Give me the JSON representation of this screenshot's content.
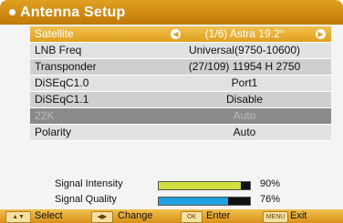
{
  "header": {
    "title": "Antenna Setup"
  },
  "menu": {
    "satellite": {
      "label": "Satellite",
      "value": "(1/6) Astra 19.2°"
    },
    "lnb": {
      "label": "LNB Freq",
      "value": "Universal(9750-10600)"
    },
    "transponder": {
      "label": "Transponder",
      "value": "(27/109) 11954 H 2750"
    },
    "diseqc10": {
      "label": "DiSEqC1.0",
      "value": "Port1"
    },
    "diseqc11": {
      "label": "DiSEqC1.1",
      "value": "Disable"
    },
    "k22": {
      "label": "22K",
      "value": "Auto"
    },
    "polarity": {
      "label": "Polarity",
      "value": "Auto"
    }
  },
  "signal": {
    "intensity": {
      "label": "Signal Intensity",
      "percent": "90%",
      "fraction": 0.9,
      "color": "#d0e040"
    },
    "quality": {
      "label": "Signal Quality",
      "percent": "76%",
      "fraction": 0.76,
      "color": "#20a0e0"
    }
  },
  "footer": {
    "select_key": "▲▼",
    "select_label": "Select",
    "change_key": "◀▶",
    "change_label": "Change",
    "enter_key": "OK",
    "enter_label": "Enter",
    "exit_key": "MENU",
    "exit_label": "Exit"
  },
  "colors": {
    "accent": "#e0a020",
    "disabled_row": "#8a8a8a"
  }
}
